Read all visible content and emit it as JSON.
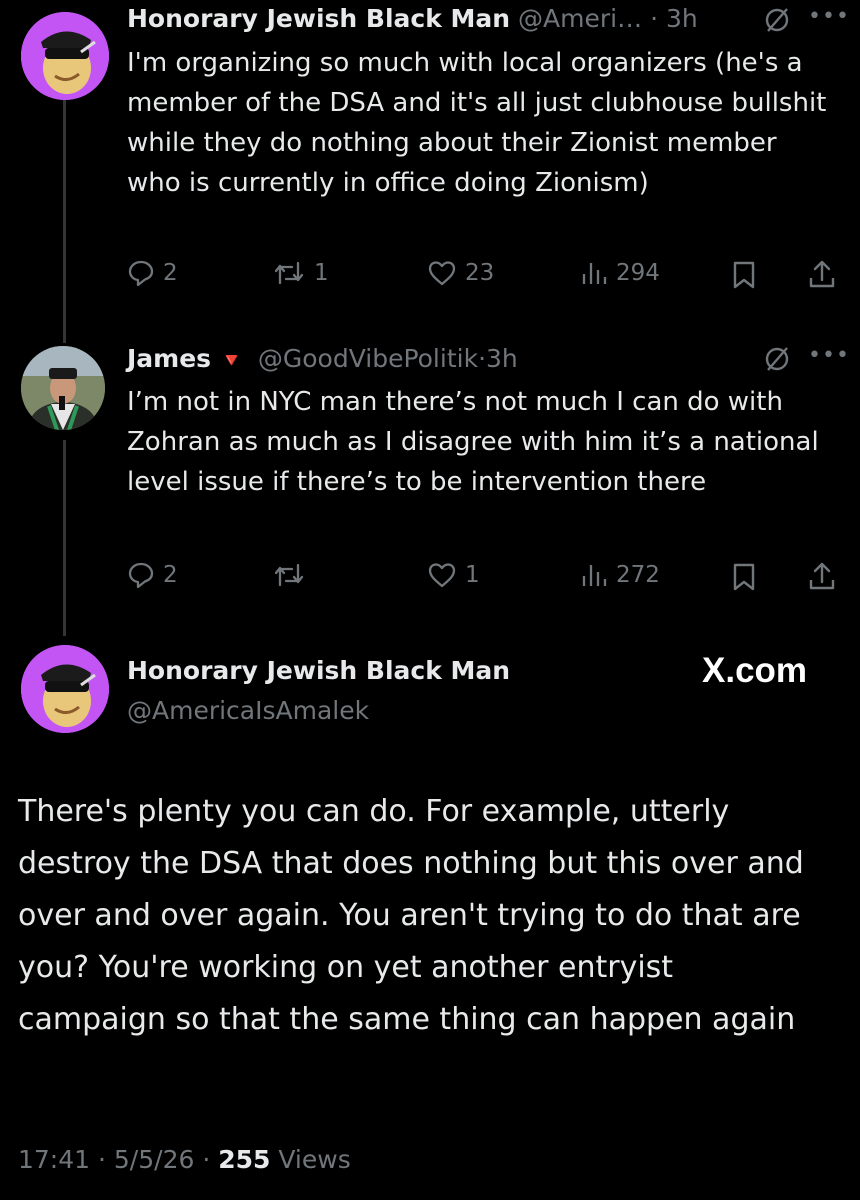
{
  "tweet1": {
    "name": "Honorary Jewish Black Man",
    "handle": "@Ameri…",
    "sep": "·",
    "time": "3h",
    "text": "I'm organizing so much with local organizers (he's a member of the DSA and it's all just clubhouse bullshit while they do nothing about their Zionist member who is currently in office doing Zionism)",
    "replies": "2",
    "reposts": "1",
    "likes": "23",
    "views": "294"
  },
  "tweet2": {
    "name": "James",
    "flag": "🔻",
    "handle": "@GoodVibePolitik",
    "sep": "·",
    "time": "3h",
    "text": "I’m not in NYC man there’s not much I can do with Zohran as much as I disagree with him it’s a national level issue if there’s to be intervention there",
    "replies": "2",
    "reposts": "",
    "likes": "1",
    "views": "272"
  },
  "main": {
    "name": "Honorary Jewish Black Man",
    "handle": "@AmericaIsAmalek",
    "watermark": "X.com",
    "text": "There's plenty you can do. For example, utterly destroy the DSA that does nothing but this over and over and over again. You aren't trying to do that are you? You're working on yet another entryist campaign so that the same thing can happen again",
    "time": "17:41",
    "sep1": "·",
    "date": "5/5/26",
    "sep2": "·",
    "views_count": "255",
    "views_label": "Views"
  },
  "icons": {
    "more": "more-dots-icon",
    "grok": "grok-icon",
    "reply": "reply-icon",
    "repost": "repost-icon",
    "like": "heart-icon",
    "views": "views-icon",
    "bookmark": "bookmark-icon",
    "share": "share-icon"
  },
  "colors": {
    "background": "#000000",
    "text": "#e7e9ea",
    "secondary": "#71767b",
    "avatar_purple": "#c455f5",
    "flag_red": "#e0533d"
  }
}
